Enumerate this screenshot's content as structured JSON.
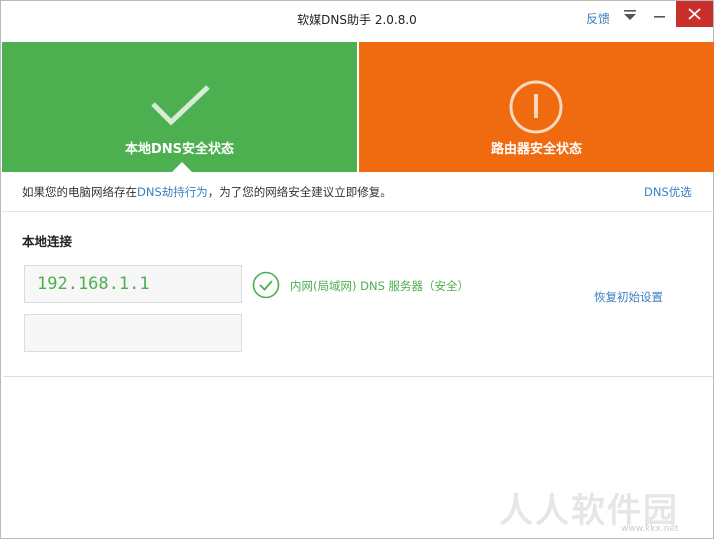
{
  "window": {
    "title": "软媒DNS助手 2.0.8.0",
    "feedback_label": "反馈",
    "menu_icon": "chevron-down-icon",
    "minimize_icon": "minimize-icon",
    "close_icon": "close-icon"
  },
  "tiles": {
    "local": {
      "label": "本地DNS安全状态",
      "icon": "check-icon",
      "color": "#4caf50"
    },
    "router": {
      "label": "路由器安全状态",
      "icon": "exclamation-circle-icon",
      "color": "#f06a0f"
    }
  },
  "notice": {
    "text_before": "如果您的电脑网络存在",
    "link_text": "DNS劫持行为",
    "text_after": "，为了您的网络安全建议立即修复。",
    "dns_optimize_label": "DNS优选"
  },
  "local_connection": {
    "title": "本地连接",
    "dns_primary": "192.168.1.1",
    "dns_secondary": "",
    "status_text": "内网(局域网) DNS 服务器（安全）",
    "status_icon": "check-circle-icon",
    "restore_label": "恢复初始设置"
  },
  "watermark": {
    "text": "人人软件园",
    "url": "www.kkx.net"
  }
}
